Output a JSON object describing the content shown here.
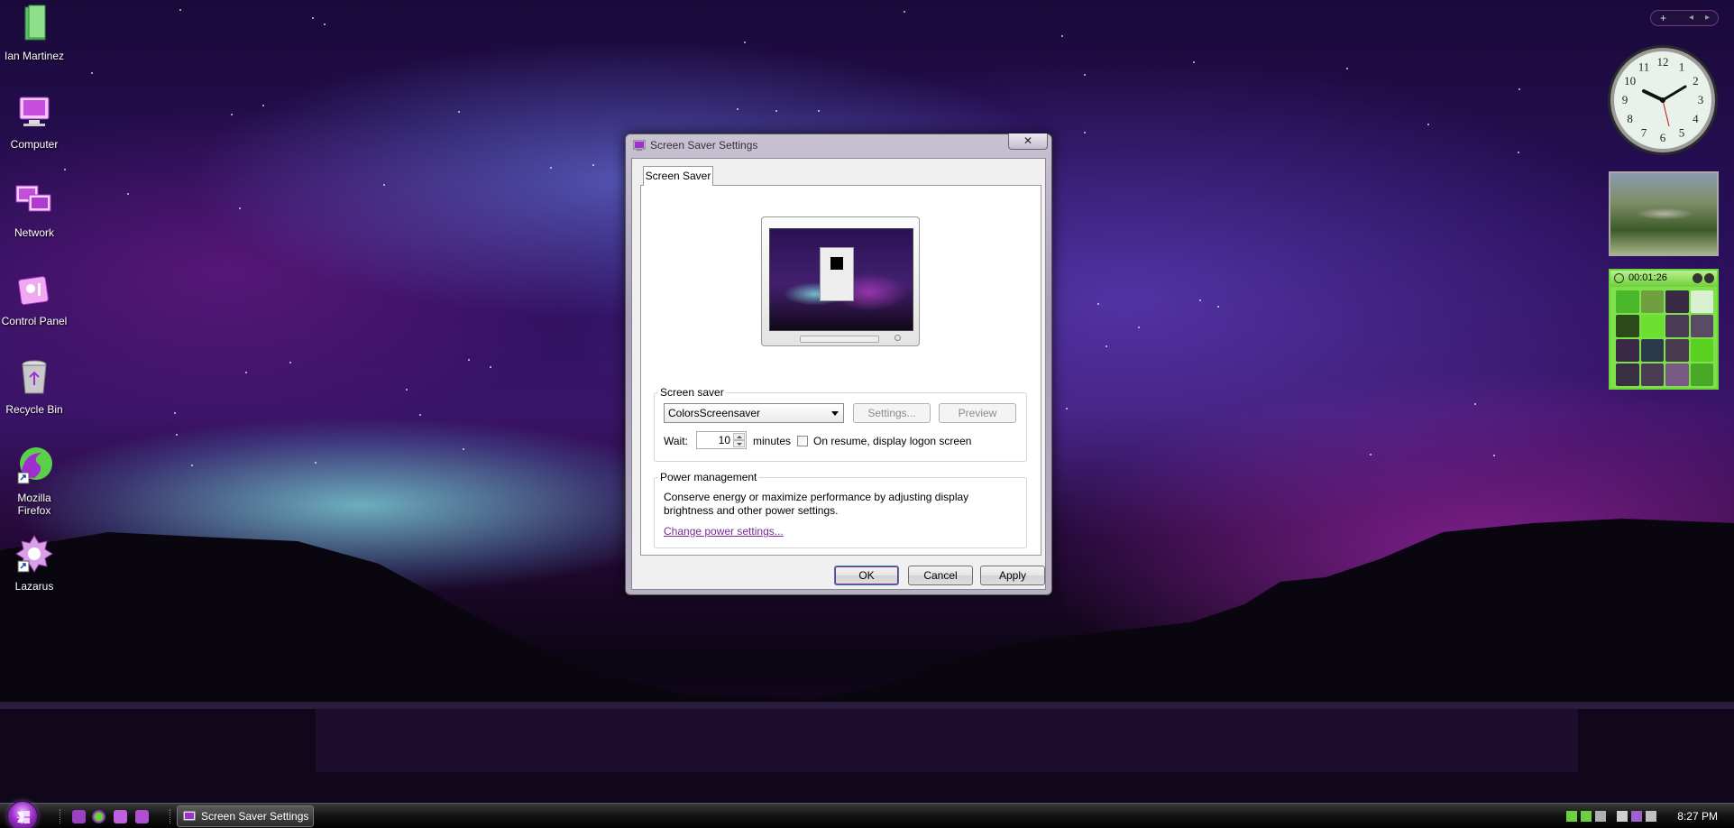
{
  "desktop": {
    "icons": [
      {
        "label": "Ian Martinez",
        "icon": "user-folder-icon"
      },
      {
        "label": "Computer",
        "icon": "computer-icon"
      },
      {
        "label": "Network",
        "icon": "network-icon"
      },
      {
        "label": "Control Panel",
        "icon": "control-panel-icon"
      },
      {
        "label": "Recycle Bin",
        "icon": "recycle-bin-icon"
      },
      {
        "label": "Mozilla Firefox",
        "icon": "firefox-icon"
      },
      {
        "label": "Lazarus",
        "icon": "lazarus-icon"
      }
    ]
  },
  "dialog": {
    "title": "Screen Saver Settings",
    "close_label": "✕",
    "tab_label": "Screen Saver",
    "screen_saver_group": {
      "legend": "Screen saver",
      "selected": "ColorsScreensaver",
      "settings_label": "Settings...",
      "preview_label": "Preview",
      "wait_label": "Wait:",
      "wait_value": "10",
      "minutes_label": "minutes",
      "on_resume_label": "On resume, display logon screen",
      "on_resume_checked": false
    },
    "power_group": {
      "legend": "Power management",
      "description": "Conserve energy or maximize performance by adjusting display brightness and other power settings.",
      "link": "Change power settings..."
    },
    "buttons": {
      "ok": "OK",
      "cancel": "Cancel",
      "apply": "Apply"
    }
  },
  "taskbar": {
    "active_item": "Screen Saver Settings",
    "clock": "8:27 PM"
  },
  "sidebar": {
    "add_label": "+",
    "prev_label": "◂",
    "next_label": "▸",
    "clock_numbers": [
      "12",
      "1",
      "2",
      "3",
      "4",
      "5",
      "6",
      "7",
      "8",
      "9",
      "10",
      "11"
    ],
    "puzzle_timer": "00:01:26"
  },
  "colors": {
    "accent": "#a02fd0",
    "link": "#7a2a9a",
    "puzzle_green": "#7ee04a"
  }
}
